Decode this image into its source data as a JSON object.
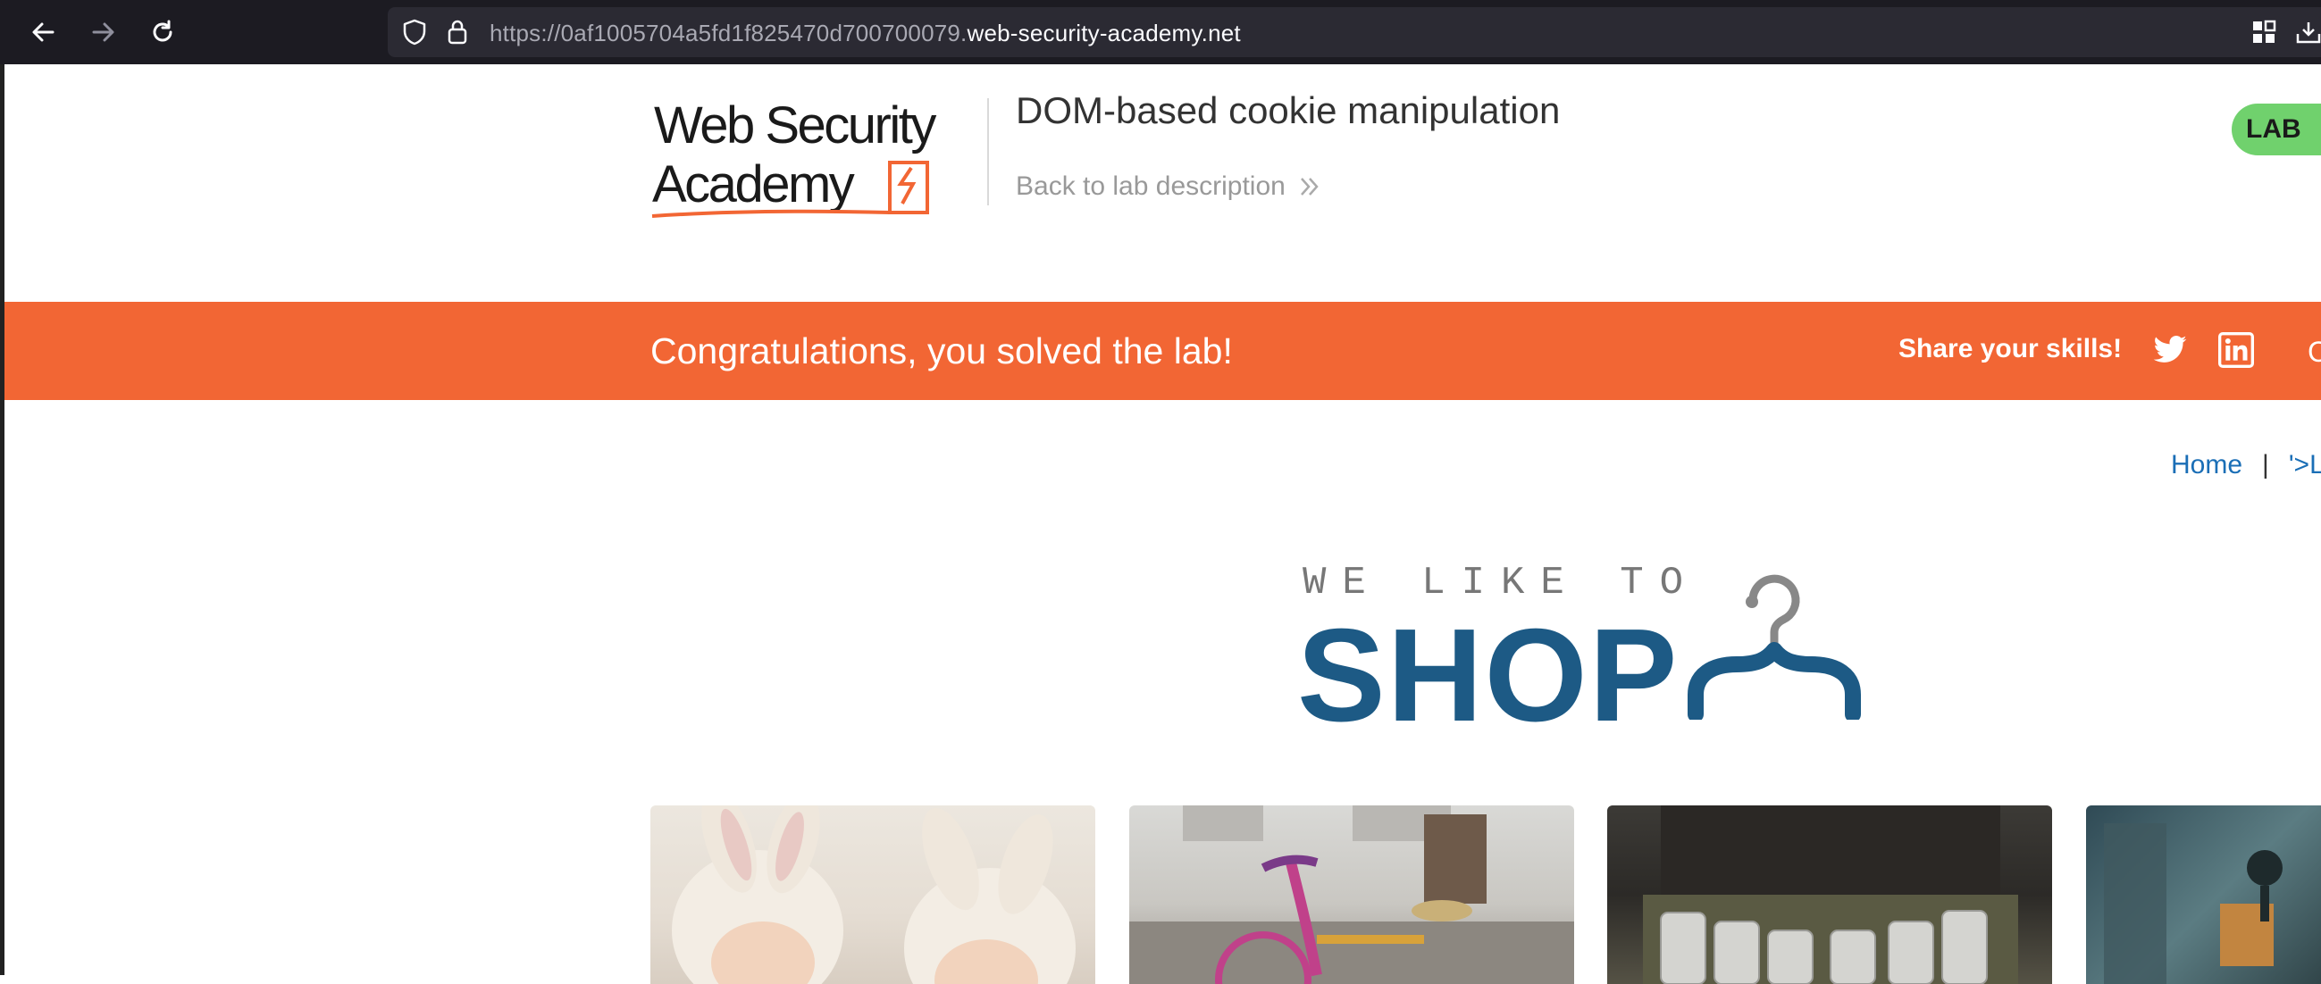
{
  "browser": {
    "url_prefix": "https://0af1005704a5fd1f825470d700700079.",
    "url_domain": "web-security-academy.net",
    "icons": [
      "back-arrow-icon",
      "forward-arrow-icon",
      "reload-icon",
      "shield-icon",
      "lock-icon",
      "extensions-icon",
      "downloads-icon"
    ]
  },
  "header": {
    "logo_line1": "Web Security",
    "logo_line2": "Academy",
    "lab_title": "DOM-based cookie manipulation",
    "back_link": "Back to lab description",
    "badge": "LAB"
  },
  "banner": {
    "message": "Congratulations, you solved the lab!",
    "share": "Share your skills!",
    "cut_text": "C",
    "icons": [
      "twitter-icon",
      "linkedin-icon"
    ]
  },
  "nav": {
    "home": "Home",
    "separator": "|",
    "last_viewed": "'>La"
  },
  "shop_logo": {
    "tagline": "WE LIKE TO",
    "word": "SHOP"
  },
  "colors": {
    "brand_orange": "#f26634",
    "shop_blue": "#1d5a85",
    "lab_green": "#70d16d",
    "link_blue": "#1a6eb6"
  }
}
